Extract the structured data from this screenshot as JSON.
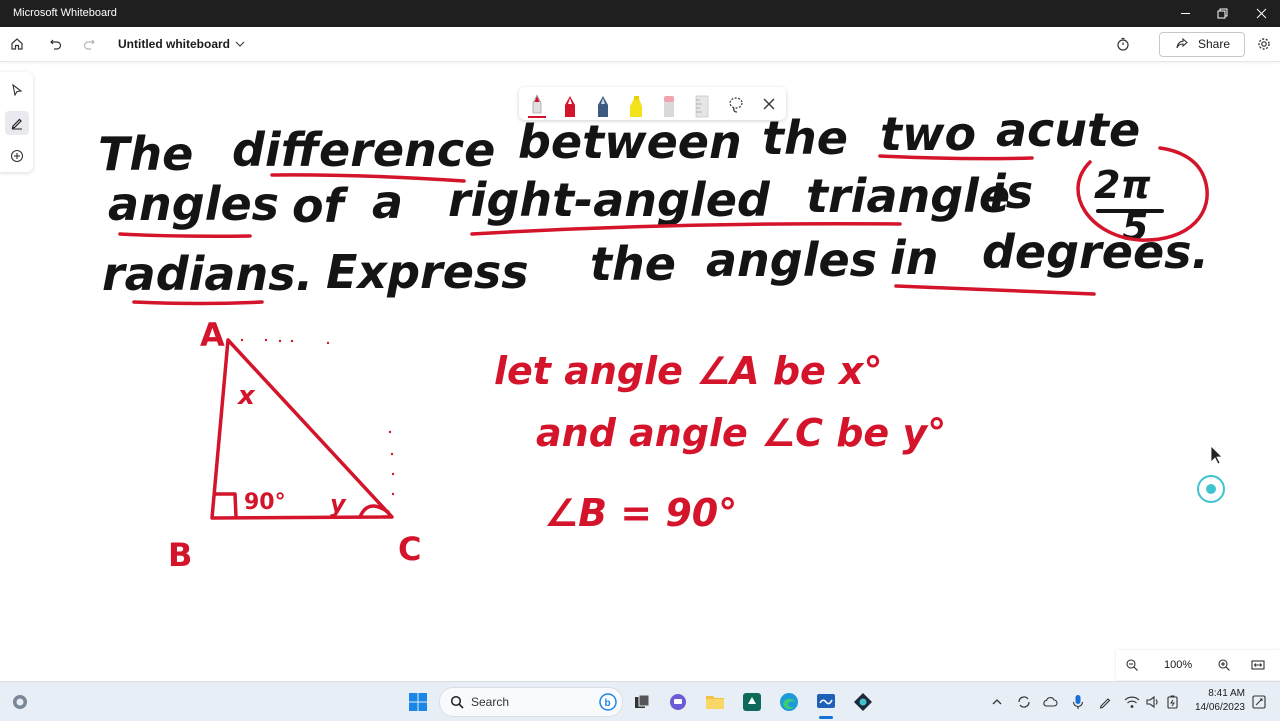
{
  "titlebar": {
    "title": "Microsoft Whiteboard"
  },
  "toolbar": {
    "whiteboard_name": "Untitled whiteboard",
    "share_label": "Share"
  },
  "zoom": {
    "level": "100%"
  },
  "taskbar": {
    "search_placeholder": "Search",
    "time": "8:41 AM",
    "date": "14/06/2023"
  },
  "ink": {
    "question_line1": [
      "The",
      "difference",
      "between",
      "the",
      "two",
      "acute"
    ],
    "question_line2": [
      "angles",
      "of",
      "a",
      "right-angled",
      "triangle",
      "is"
    ],
    "fraction_numerator": "2π",
    "fraction_denominator": "5",
    "question_line3": [
      "radians.",
      "Express",
      "the",
      "angles",
      "in",
      "degrees."
    ],
    "triangle_vertex_a": "A",
    "triangle_vertex_b": "B",
    "triangle_vertex_c": "C",
    "angle_a_label": "x",
    "angle_b_label": "90°",
    "angle_c_label": "y",
    "work_line1": "let angle ∠A be x°",
    "work_line2": "and angle ∠C be y°",
    "work_line3": "∠B = 90°"
  },
  "colors": {
    "ink_black": "#141414",
    "ink_red": "#d4142a",
    "accent": "#1673d8"
  }
}
